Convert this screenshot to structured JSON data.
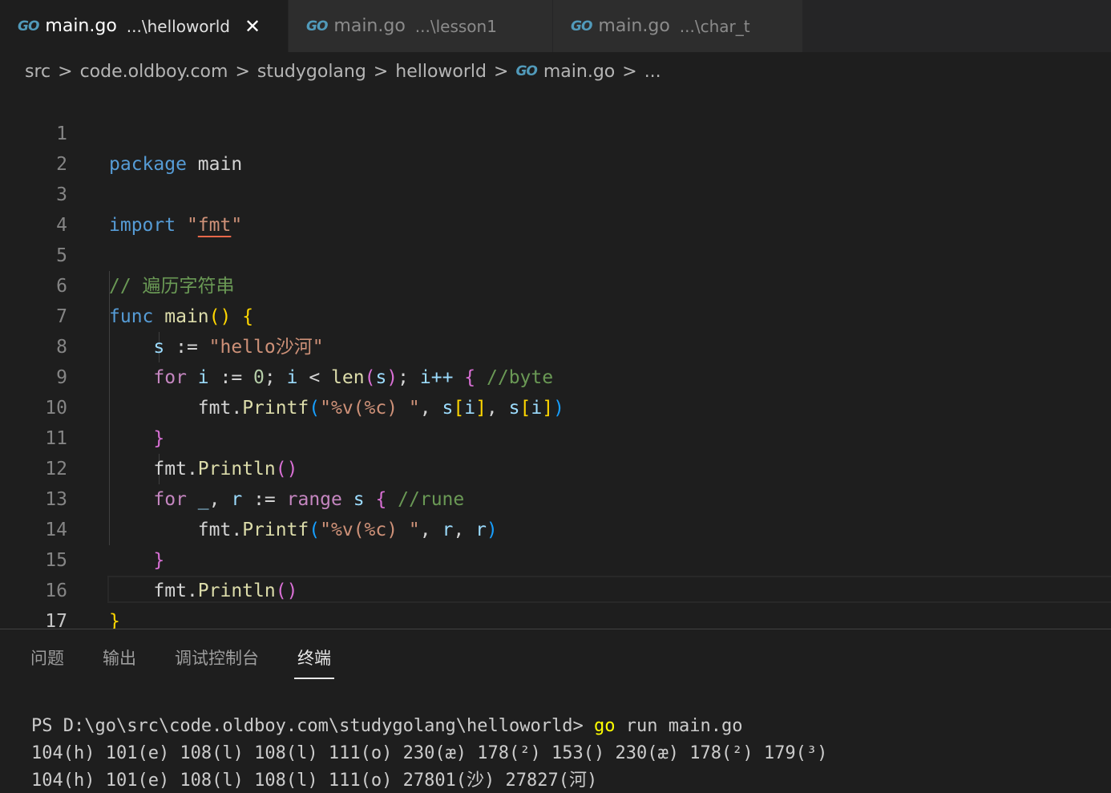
{
  "tabs": [
    {
      "icon": "GO",
      "name": "main.go",
      "path": "...\\helloworld",
      "close": "✕"
    },
    {
      "icon": "GO",
      "name": "main.go",
      "path": "...\\lesson1"
    },
    {
      "icon": "GO",
      "name": "main.go",
      "path": "...\\char_t"
    }
  ],
  "breadcrumb": {
    "items": [
      "src",
      "code.oldboy.com",
      "studygolang",
      "helloworld"
    ],
    "file_icon": "GO",
    "file": "main.go",
    "more": "...",
    "separator": ">"
  },
  "editor": {
    "line_numbers": [
      "1",
      "2",
      "3",
      "4",
      "5",
      "6",
      "7",
      "8",
      "9",
      "10",
      "11",
      "12",
      "13",
      "14",
      "15",
      "16",
      "17"
    ],
    "tokens": {
      "package": "package",
      "main": "main",
      "import": "import",
      "q": "\"",
      "fmt": "fmt",
      "comment_traverse": "// 遍历字符串",
      "func": "func",
      "main_fn": "main",
      "lparen": "(",
      "rparen": ")",
      "lbrace": "{",
      "rbrace": "}",
      "s": "s",
      "assign": " := ",
      "hello_str": "\"hello沙河\"",
      "for": "for",
      "i": "i",
      "zero": "0",
      "semi": ";",
      "lt": " < ",
      "len": "len",
      "inc": "i++",
      "cmt_byte": "//byte",
      "cmt_rune": "//rune",
      "fmt_pkg": "fmt",
      "dot": ".",
      "printf": "Printf",
      "println": "Println",
      "fmt_str": "\"%v(%c) \"",
      "comma": ",",
      "lbr": "[",
      "rbr": "]",
      "underscore": "_",
      "r": "r",
      "range": "range"
    }
  },
  "panel": {
    "tabs": [
      "问题",
      "输出",
      "调试控制台",
      "终端"
    ],
    "active_tab": "终端",
    "terminal": {
      "prompt": "PS D:\\go\\src\\code.oldboy.com\\studygolang\\helloworld> ",
      "cmd_go": "go",
      "cmd_rest": " run main.go",
      "output_bytes": "104(h) 101(e) 108(l) 108(l) 111(o) 230(æ) 178(²) 153() 230(æ) 178(²) 179(³)",
      "output_runes": "104(h) 101(e) 108(l) 108(l) 111(o) 27801(沙) 27827(河)"
    }
  },
  "colors": {
    "background": "#1e1e1e",
    "keyword": "#569cd6",
    "control": "#c586c0",
    "function": "#dcdcaa",
    "string": "#ce9178",
    "comment": "#6a9955",
    "go_icon": "#519aba"
  }
}
